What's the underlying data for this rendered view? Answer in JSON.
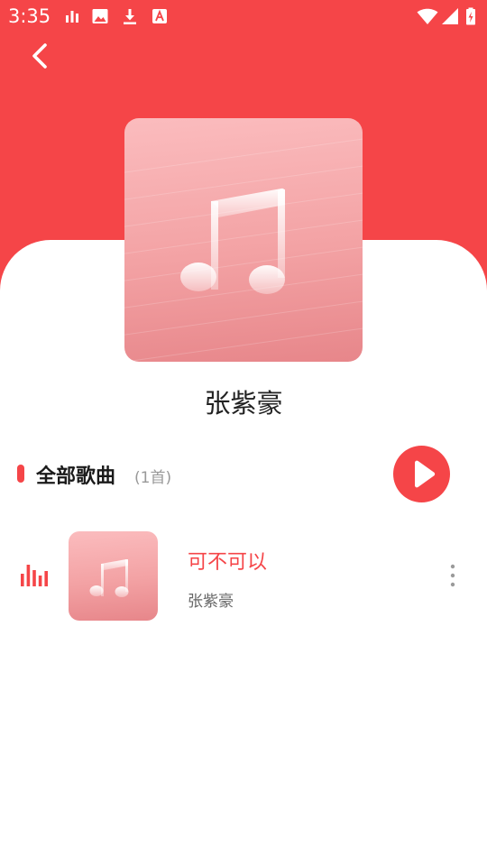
{
  "status_bar": {
    "time": "3:35",
    "left_icons": [
      "bar-chart-icon",
      "image-icon",
      "download-icon",
      "font-icon"
    ],
    "right_icons": [
      "wifi-icon",
      "signal-icon",
      "battery-charging-icon"
    ]
  },
  "colors": {
    "accent": "#f54548",
    "cover_gradient_top": "#fbbcbe",
    "cover_gradient_bottom": "#e7868a"
  },
  "header": {
    "back_icon": "chevron-left-icon",
    "cover_icon": "music-note-icon"
  },
  "artist": {
    "name": "张紫豪"
  },
  "section": {
    "title": "全部歌曲",
    "count": "(1首)",
    "play_all_icon": "play-icon"
  },
  "songs": [
    {
      "title": "可不可以",
      "artist": "张紫豪",
      "playing_icon": "equalizer-icon",
      "more_icon": "more-vertical-icon"
    }
  ]
}
